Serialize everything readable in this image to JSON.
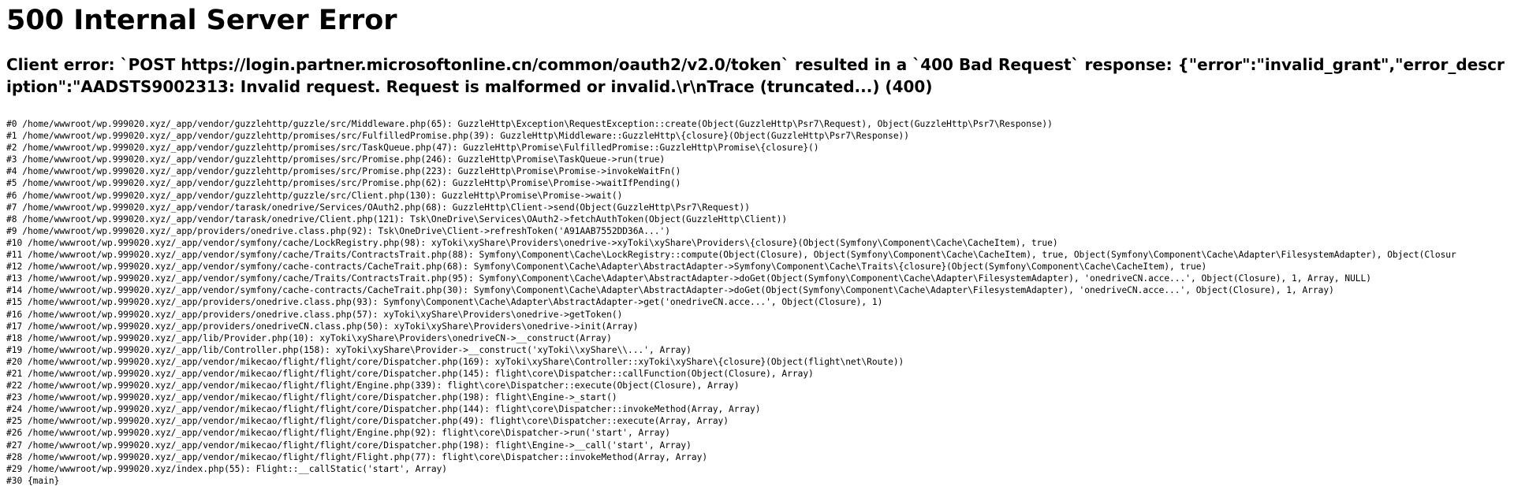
{
  "error": {
    "title": "500 Internal Server Error",
    "message": "Client error: `POST https://login.partner.microsoftonline.cn/common/oauth2/v2.0/token` resulted in a `400 Bad Request` response: {\"error\":\"invalid_grant\",\"error_description\":\"AADSTS9002313: Invalid request. Request is malformed or invalid.\\r\\nTrace (truncated...) (400)"
  },
  "trace": [
    "#0 /home/wwwroot/wp.999020.xyz/_app/vendor/guzzlehttp/guzzle/src/Middleware.php(65): GuzzleHttp\\Exception\\RequestException::create(Object(GuzzleHttp\\Psr7\\Request), Object(GuzzleHttp\\Psr7\\Response))",
    "#1 /home/wwwroot/wp.999020.xyz/_app/vendor/guzzlehttp/promises/src/FulfilledPromise.php(39): GuzzleHttp\\Middleware::GuzzleHttp\\{closure}(Object(GuzzleHttp\\Psr7\\Response))",
    "#2 /home/wwwroot/wp.999020.xyz/_app/vendor/guzzlehttp/promises/src/TaskQueue.php(47): GuzzleHttp\\Promise\\FulfilledPromise::GuzzleHttp\\Promise\\{closure}()",
    "#3 /home/wwwroot/wp.999020.xyz/_app/vendor/guzzlehttp/promises/src/Promise.php(246): GuzzleHttp\\Promise\\TaskQueue->run(true)",
    "#4 /home/wwwroot/wp.999020.xyz/_app/vendor/guzzlehttp/promises/src/Promise.php(223): GuzzleHttp\\Promise\\Promise->invokeWaitFn()",
    "#5 /home/wwwroot/wp.999020.xyz/_app/vendor/guzzlehttp/promises/src/Promise.php(62): GuzzleHttp\\Promise\\Promise->waitIfPending()",
    "#6 /home/wwwroot/wp.999020.xyz/_app/vendor/guzzlehttp/guzzle/src/Client.php(130): GuzzleHttp\\Promise\\Promise->wait()",
    "#7 /home/wwwroot/wp.999020.xyz/_app/vendor/tarask/onedrive/Services/OAuth2.php(68): GuzzleHttp\\Client->send(Object(GuzzleHttp\\Psr7\\Request))",
    "#8 /home/wwwroot/wp.999020.xyz/_app/vendor/tarask/onedrive/Client.php(121): Tsk\\OneDrive\\Services\\OAuth2->fetchAuthToken(Object(GuzzleHttp\\Client))",
    "#9 /home/wwwroot/wp.999020.xyz/_app/providers/onedrive.class.php(92): Tsk\\OneDrive\\Client->refreshToken('A91AAB7552DD36A...')",
    "#10 /home/wwwroot/wp.999020.xyz/_app/vendor/symfony/cache/LockRegistry.php(98): xyToki\\xyShare\\Providers\\onedrive->xyToki\\xyShare\\Providers\\{closure}(Object(Symfony\\Component\\Cache\\CacheItem), true)",
    "#11 /home/wwwroot/wp.999020.xyz/_app/vendor/symfony/cache/Traits/ContractsTrait.php(88): Symfony\\Component\\Cache\\LockRegistry::compute(Object(Closure), Object(Symfony\\Component\\Cache\\CacheItem), true, Object(Symfony\\Component\\Cache\\Adapter\\FilesystemAdapter), Object(Closur",
    "#12 /home/wwwroot/wp.999020.xyz/_app/vendor/symfony/cache-contracts/CacheTrait.php(68): Symfony\\Component\\Cache\\Adapter\\AbstractAdapter->Symfony\\Component\\Cache\\Traits\\{closure}(Object(Symfony\\Component\\Cache\\CacheItem), true)",
    "#13 /home/wwwroot/wp.999020.xyz/_app/vendor/symfony/cache/Traits/ContractsTrait.php(95): Symfony\\Component\\Cache\\Adapter\\AbstractAdapter->doGet(Object(Symfony\\Component\\Cache\\Adapter\\FilesystemAdapter), 'onedriveCN.acce...', Object(Closure), 1, Array, NULL)",
    "#14 /home/wwwroot/wp.999020.xyz/_app/vendor/symfony/cache-contracts/CacheTrait.php(30): Symfony\\Component\\Cache\\Adapter\\AbstractAdapter->doGet(Object(Symfony\\Component\\Cache\\Adapter\\FilesystemAdapter), 'onedriveCN.acce...', Object(Closure), 1, Array)",
    "#15 /home/wwwroot/wp.999020.xyz/_app/providers/onedrive.class.php(93): Symfony\\Component\\Cache\\Adapter\\AbstractAdapter->get('onedriveCN.acce...', Object(Closure), 1)",
    "#16 /home/wwwroot/wp.999020.xyz/_app/providers/onedrive.class.php(57): xyToki\\xyShare\\Providers\\onedrive->getToken()",
    "#17 /home/wwwroot/wp.999020.xyz/_app/providers/onedriveCN.class.php(50): xyToki\\xyShare\\Providers\\onedrive->init(Array)",
    "#18 /home/wwwroot/wp.999020.xyz/_app/lib/Provider.php(10): xyToki\\xyShare\\Providers\\onedriveCN->__construct(Array)",
    "#19 /home/wwwroot/wp.999020.xyz/_app/lib/Controller.php(158): xyToki\\xyShare\\Provider->__construct('xyToki\\\\xyShare\\\\...', Array)",
    "#20 /home/wwwroot/wp.999020.xyz/_app/vendor/mikecao/flight/flight/core/Dispatcher.php(169): xyToki\\xyShare\\Controller::xyToki\\xyShare\\{closure}(Object(flight\\net\\Route))",
    "#21 /home/wwwroot/wp.999020.xyz/_app/vendor/mikecao/flight/flight/core/Dispatcher.php(145): flight\\core\\Dispatcher::callFunction(Object(Closure), Array)",
    "#22 /home/wwwroot/wp.999020.xyz/_app/vendor/mikecao/flight/flight/Engine.php(339): flight\\core\\Dispatcher::execute(Object(Closure), Array)",
    "#23 /home/wwwroot/wp.999020.xyz/_app/vendor/mikecao/flight/flight/core/Dispatcher.php(198): flight\\Engine->_start()",
    "#24 /home/wwwroot/wp.999020.xyz/_app/vendor/mikecao/flight/flight/core/Dispatcher.php(144): flight\\core\\Dispatcher::invokeMethod(Array, Array)",
    "#25 /home/wwwroot/wp.999020.xyz/_app/vendor/mikecao/flight/flight/core/Dispatcher.php(49): flight\\core\\Dispatcher::execute(Array, Array)",
    "#26 /home/wwwroot/wp.999020.xyz/_app/vendor/mikecao/flight/flight/Engine.php(92): flight\\core\\Dispatcher->run('start', Array)",
    "#27 /home/wwwroot/wp.999020.xyz/_app/vendor/mikecao/flight/flight/core/Dispatcher.php(198): flight\\Engine->__call('start', Array)",
    "#28 /home/wwwroot/wp.999020.xyz/_app/vendor/mikecao/flight/flight/Flight.php(77): flight\\core\\Dispatcher::invokeMethod(Array, Array)",
    "#29 /home/wwwroot/wp.999020.xyz/index.php(55): Flight::__callStatic('start', Array)",
    "#30 {main}"
  ]
}
